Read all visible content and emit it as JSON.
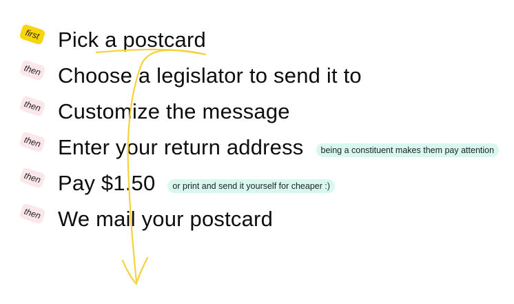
{
  "steps": [
    {
      "badge": "first",
      "text": "Pick a postcard",
      "note": ""
    },
    {
      "badge": "then",
      "text": "Choose a legislator to send it to",
      "note": ""
    },
    {
      "badge": "then",
      "text": "Customize the message",
      "note": ""
    },
    {
      "badge": "then",
      "text": "Enter your return address",
      "note": "being a constituent makes them pay attention"
    },
    {
      "badge": "then",
      "text": "Pay $1.50",
      "note": "or print and send it yourself for cheaper :)"
    },
    {
      "badge": "then",
      "text": "We mail your postcard",
      "note": ""
    }
  ],
  "colors": {
    "first_badge": "#f8d40a",
    "then_badge": "#fbe6ea",
    "note_bg": "#d8f7ee",
    "arrow": "#f7d13a"
  }
}
